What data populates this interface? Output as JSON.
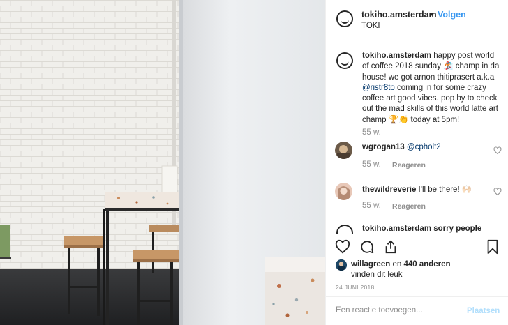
{
  "post": {
    "username": "tokiho.amsterdam",
    "separator": "•",
    "follow_label": "Volgen",
    "location": "TOKI",
    "avatar_icon": "tokiho-smile-logo"
  },
  "caption": {
    "username": "tokiho.amsterdam",
    "text_1": " happy post world of coffee 2018 sunday ",
    "emoji_1": "🏂",
    "text_2": " champ in da house! we got arnon thitiprasert a.k.a ",
    "mention": "@ristr8to",
    "text_3": " coming in for some crazy coffee art good vibes. pop by to check out the mad skills of this world latte art champ ",
    "emoji_2": "🏆👏",
    "text_4": " today at 5pm!",
    "time": "55 w."
  },
  "comments": [
    {
      "username": "wgrogan13",
      "mention": "@cpholt2",
      "text": "",
      "time": "55 w.",
      "reply_label": "Reageren"
    },
    {
      "username": "thewildreverie",
      "mention": "",
      "text": "I'll be there! 🙌🏻",
      "time": "55 w.",
      "reply_label": "Reageren"
    }
  ],
  "partial_comment": {
    "text": "tokiho.amsterdam sorry people"
  },
  "likes": {
    "liker": "willagreen",
    "conjunction": "en",
    "others": "440 anderen",
    "suffix": "vinden dit leuk"
  },
  "date": "24 JUNI 2018",
  "add_comment": {
    "placeholder": "Een reactie toevoegen...",
    "post_label": "Plaatsen"
  },
  "icons": {
    "like": "heart-icon",
    "comment": "comment-bubble-icon",
    "share": "share-icon",
    "save": "bookmark-icon",
    "comment_like": "small-heart-icon"
  },
  "colors": {
    "link_blue": "#3897f0",
    "mention_blue": "#003569",
    "muted_text": "#8e8e8e",
    "disabled_blue": "#b2dffc",
    "border": "#efefef"
  }
}
